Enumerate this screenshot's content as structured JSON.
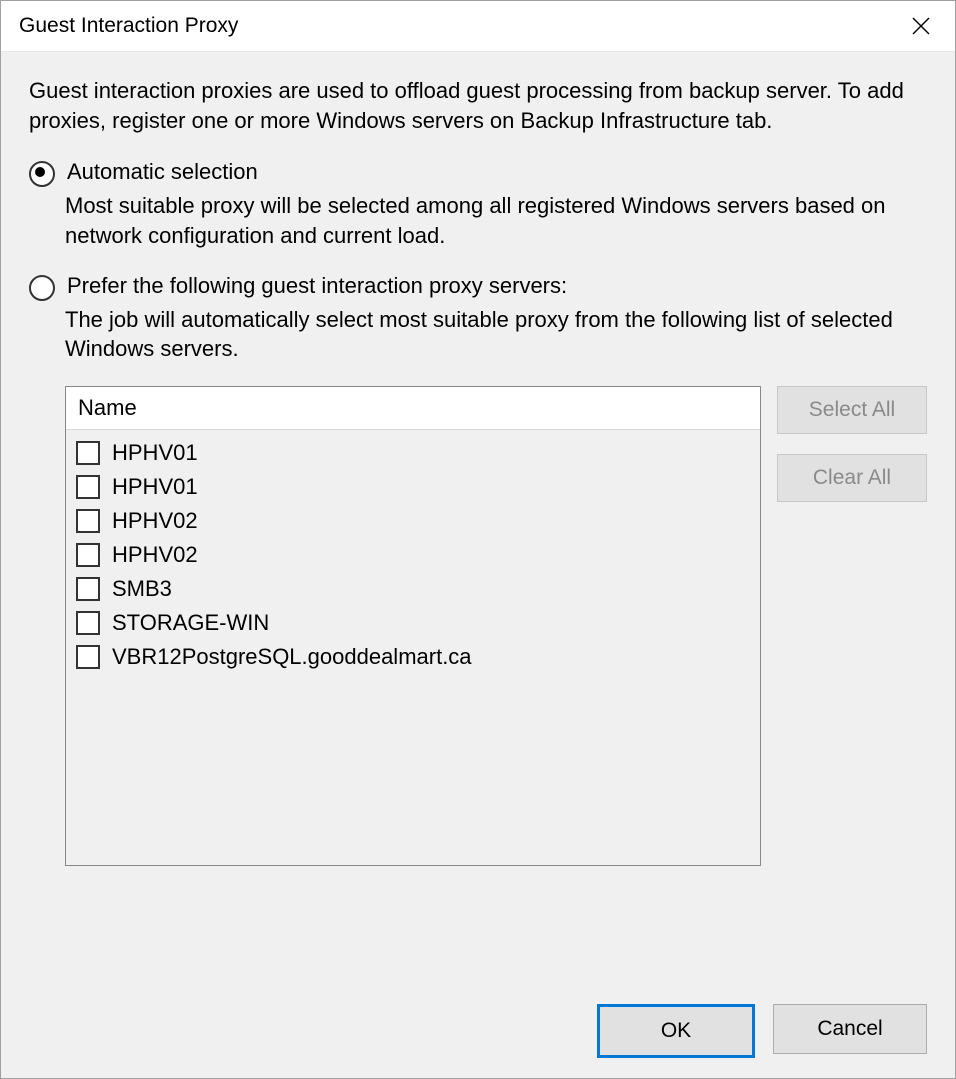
{
  "window": {
    "title": "Guest Interaction Proxy"
  },
  "intro": "Guest interaction proxies are used to offload guest processing from backup server. To add proxies, register one or more Windows servers on Backup Infrastructure tab.",
  "options": {
    "auto": {
      "label": "Automatic selection",
      "desc": "Most suitable proxy will be selected among all registered Windows servers based on network configuration and current load.",
      "selected": true
    },
    "prefer": {
      "label": "Prefer the following guest interaction proxy servers:",
      "desc": "The job will automatically select most suitable proxy from the following list of selected Windows servers.",
      "selected": false
    }
  },
  "list": {
    "header": "Name",
    "items": [
      {
        "label": "HPHV01",
        "checked": false
      },
      {
        "label": "HPHV01",
        "checked": false
      },
      {
        "label": "HPHV02",
        "checked": false
      },
      {
        "label": "HPHV02",
        "checked": false
      },
      {
        "label": "SMB3",
        "checked": false
      },
      {
        "label": "STORAGE-WIN",
        "checked": false
      },
      {
        "label": "VBR12PostgreSQL.gooddealmart.ca",
        "checked": false
      }
    ]
  },
  "buttons": {
    "select_all": "Select All",
    "clear_all": "Clear All",
    "ok": "OK",
    "cancel": "Cancel"
  }
}
